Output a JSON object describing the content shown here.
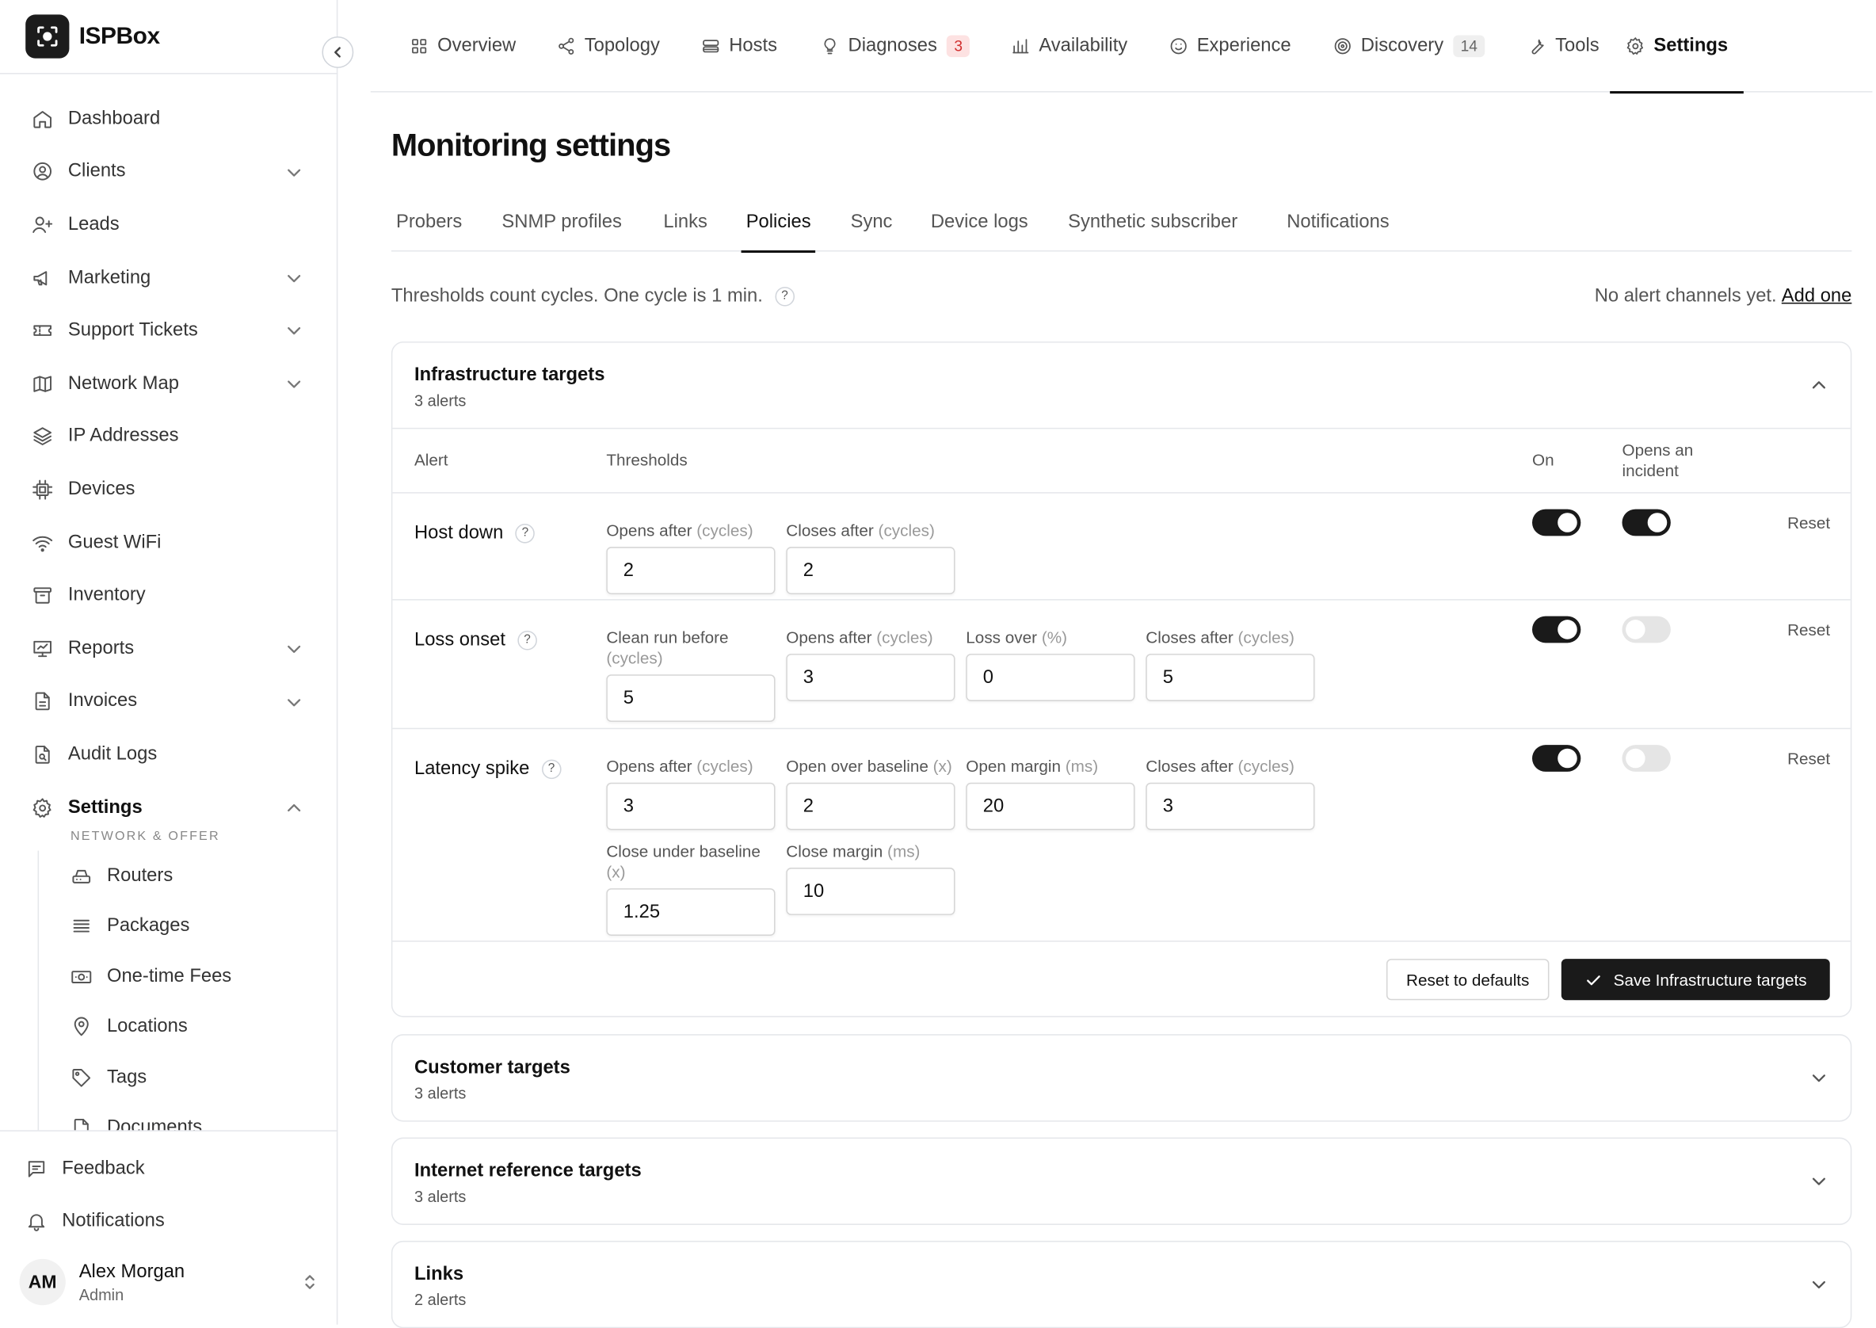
{
  "app": {
    "name": "ISPBox"
  },
  "sidebar": {
    "items": [
      {
        "label": "Dashboard",
        "icon": "home-icon"
      },
      {
        "label": "Clients",
        "icon": "user-circle-icon",
        "expandable": true
      },
      {
        "label": "Leads",
        "icon": "user-plus-icon"
      },
      {
        "label": "Marketing",
        "icon": "megaphone-icon",
        "expandable": true
      },
      {
        "label": "Support Tickets",
        "icon": "ticket-icon",
        "expandable": true
      },
      {
        "label": "Network Map",
        "icon": "map-icon",
        "expandable": true
      },
      {
        "label": "IP Addresses",
        "icon": "layers-icon"
      },
      {
        "label": "Devices",
        "icon": "chip-icon"
      },
      {
        "label": "Guest WiFi",
        "icon": "wifi-icon"
      },
      {
        "label": "Inventory",
        "icon": "archive-icon"
      },
      {
        "label": "Reports",
        "icon": "chart-icon",
        "expandable": true
      },
      {
        "label": "Invoices",
        "icon": "file-icon",
        "expandable": true
      },
      {
        "label": "Audit Logs",
        "icon": "file-search-icon"
      },
      {
        "label": "Settings",
        "icon": "gear-icon",
        "expanded": true
      }
    ],
    "section_label": "NETWORK & OFFER",
    "sub_items": [
      {
        "label": "Routers",
        "icon": "router-icon"
      },
      {
        "label": "Packages",
        "icon": "stack-icon"
      },
      {
        "label": "One-time Fees",
        "icon": "banknote-icon"
      },
      {
        "label": "Locations",
        "icon": "pin-icon"
      },
      {
        "label": "Tags",
        "icon": "tag-icon"
      },
      {
        "label": "Documents",
        "icon": "document-icon"
      }
    ],
    "bottom": [
      {
        "label": "Feedback",
        "icon": "message-icon"
      },
      {
        "label": "Notifications",
        "icon": "bell-icon"
      }
    ],
    "user": {
      "initials": "AM",
      "name": "Alex Morgan",
      "role": "Admin"
    }
  },
  "top_tabs": [
    {
      "label": "Overview",
      "icon": "grid-icon"
    },
    {
      "label": "Topology",
      "icon": "share-icon"
    },
    {
      "label": "Hosts",
      "icon": "server-icon"
    },
    {
      "label": "Diagnoses",
      "icon": "lightbulb-icon",
      "badge": "3"
    },
    {
      "label": "Availability",
      "icon": "bar-chart-icon"
    },
    {
      "label": "Experience",
      "icon": "smile-icon"
    },
    {
      "label": "Discovery",
      "icon": "radar-icon",
      "badge": "14"
    },
    {
      "label": "Tools",
      "icon": "wrench-icon"
    },
    {
      "label": "Settings",
      "icon": "gear-icon",
      "active": true
    }
  ],
  "page": {
    "title": "Monitoring settings",
    "sub_tabs": [
      "Probers",
      "SNMP profiles",
      "Links",
      "Policies",
      "Sync",
      "Device logs",
      "Synthetic subscriber",
      "Notifications"
    ],
    "active_sub_tab": "Policies",
    "info_text": "Thresholds count cycles. One cycle is 1 min.",
    "help_glyph": "?",
    "alert_note": "No alert channels yet.",
    "alert_link": "Add one"
  },
  "infra": {
    "title": "Infrastructure targets",
    "count": "3 alerts",
    "headers": {
      "alert": "Alert",
      "thresholds": "Thresholds",
      "on": "On",
      "incident": "Opens an incident"
    },
    "reset_label": "Reset",
    "rows": [
      {
        "name": "Host down",
        "on": true,
        "incident": true,
        "fields": [
          {
            "label": "Opens after",
            "unit": "(cycles)",
            "value": "2"
          },
          {
            "label": "Closes after",
            "unit": "(cycles)",
            "value": "2"
          }
        ]
      },
      {
        "name": "Loss onset",
        "on": true,
        "incident": false,
        "fields": [
          {
            "label": "Clean run before",
            "unit": "(cycles)",
            "value": "5"
          },
          {
            "label": "Opens after",
            "unit": "(cycles)",
            "value": "3"
          },
          {
            "label": "Loss over",
            "unit": "(%)",
            "value": "0"
          },
          {
            "label": "Closes after",
            "unit": "(cycles)",
            "value": "5"
          }
        ]
      },
      {
        "name": "Latency spike",
        "on": true,
        "incident": false,
        "fields": [
          {
            "label": "Opens after",
            "unit": "(cycles)",
            "value": "3"
          },
          {
            "label": "Open over baseline",
            "unit": "(x)",
            "value": "2"
          },
          {
            "label": "Open margin",
            "unit": "(ms)",
            "value": "20"
          },
          {
            "label": "Closes after",
            "unit": "(cycles)",
            "value": "3"
          },
          {
            "label": "Close under baseline",
            "unit": "(x)",
            "value": "1.25"
          },
          {
            "label": "Close margin",
            "unit": "(ms)",
            "value": "10"
          }
        ]
      }
    ],
    "reset_defaults": "Reset to defaults",
    "save": "Save Infrastructure targets"
  },
  "sections": [
    {
      "title": "Customer targets",
      "count": "3 alerts"
    },
    {
      "title": "Internet reference targets",
      "count": "3 alerts"
    },
    {
      "title": "Links",
      "count": "2 alerts"
    }
  ],
  "colors": {
    "accent": "#1a1a1a",
    "badge_red_bg": "#fde2e2",
    "badge_red_text": "#d12f2f",
    "border": "#e5e7eb"
  }
}
